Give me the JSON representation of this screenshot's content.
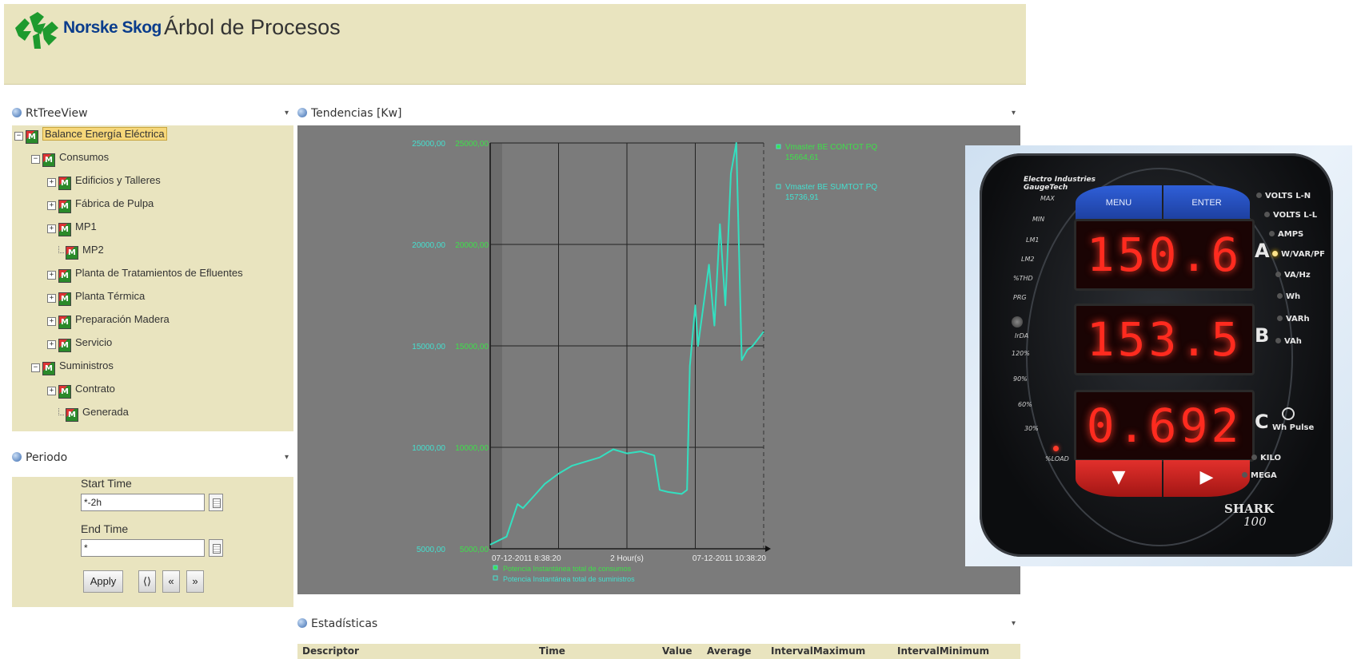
{
  "header": {
    "brand": "Norske Skog",
    "title": "Árbol de Procesos"
  },
  "tree_panel": {
    "title": "RtTreeView",
    "items": [
      {
        "label": "Balance Energía Eléctrica",
        "toggle": "−",
        "selected": true
      },
      {
        "label": "Consumos",
        "toggle": "−"
      },
      {
        "label": "Edificios y Talleres",
        "toggle": "+"
      },
      {
        "label": "Fábrica de Pulpa",
        "toggle": "+"
      },
      {
        "label": "MP1",
        "toggle": "+"
      },
      {
        "label": "MP2",
        "toggle": ""
      },
      {
        "label": "Planta de Tratamientos de Efluentes",
        "toggle": "+"
      },
      {
        "label": "Planta Térmica",
        "toggle": "+"
      },
      {
        "label": "Preparación Madera",
        "toggle": "+"
      },
      {
        "label": "Servicio",
        "toggle": "+"
      },
      {
        "label": "Suministros",
        "toggle": "−"
      },
      {
        "label": "Contrato",
        "toggle": "+"
      },
      {
        "label": "Generada",
        "toggle": ""
      }
    ]
  },
  "period_panel": {
    "title": "Periodo",
    "start_label": "Start Time",
    "start_value": "*-2h",
    "end_label": "End Time",
    "end_value": "*",
    "apply_label": "Apply",
    "btn_cycle": "⟨⟩",
    "btn_back": "«",
    "btn_forward": "»"
  },
  "trend_panel": {
    "title": "Tendencias [Kw]"
  },
  "chart_data": {
    "type": "line",
    "y_ticks": [
      "25000,00",
      "20000,00",
      "15000,00",
      "10000,00",
      "5000,00"
    ],
    "y_tick_values": [
      25000,
      20000,
      15000,
      10000,
      5000
    ],
    "ylim": [
      5000,
      25000
    ],
    "x_labels": {
      "start": "07-12-2011 8:38:20",
      "span": "2 Hour(s)",
      "end": "07-12-2011 10:38:20"
    },
    "series": [
      {
        "name": "Potencia Instantánea total de consumos",
        "tag": "Vmaster BE CONTOT PQ",
        "value": "15664,61",
        "color": "#33e0c0"
      },
      {
        "name": "Potencia Instantánea total de suministros",
        "tag": "Vmaster BE SUMTOT PQ",
        "value": "15736,91",
        "color": "#33e0c0"
      }
    ],
    "x": [
      0,
      0.03,
      0.06,
      0.1,
      0.12,
      0.16,
      0.2,
      0.25,
      0.3,
      0.35,
      0.4,
      0.45,
      0.5,
      0.55,
      0.6,
      0.62,
      0.65,
      0.7,
      0.72,
      0.73,
      0.75,
      0.76,
      0.8,
      0.82,
      0.84,
      0.86,
      0.88,
      0.9,
      0.92,
      0.94,
      0.96,
      1.0
    ],
    "y": [
      5200,
      5400,
      5600,
      7200,
      7000,
      7600,
      8200,
      8700,
      9100,
      9300,
      9500,
      9900,
      9700,
      9800,
      9600,
      7900,
      7800,
      7700,
      7900,
      14000,
      17000,
      15000,
      19000,
      16000,
      21000,
      17000,
      23500,
      25000,
      14300,
      14800,
      15000,
      15700
    ]
  },
  "stats_panel": {
    "title": "Estadísticas",
    "columns": [
      "Descriptor",
      "Time",
      "Value",
      "Average",
      "IntervalMaximum",
      "IntervalMinimum"
    ]
  },
  "meter": {
    "brand_line1": "Electro Industries",
    "brand_line2": "GaugeTech",
    "menu_label": "MENU",
    "enter_label": "ENTER",
    "display_a": "150.6",
    "display_b": "153.5",
    "display_c": "0.692",
    "letter_a": "A",
    "letter_b": "B",
    "letter_c": "C",
    "right_labels": [
      "VOLTS L-N",
      "VOLTS L-L",
      "AMPS",
      "W/VAR/PF",
      "VA/Hz",
      "Wh",
      "VARh",
      "VAh"
    ],
    "active_label_index": 3,
    "left_labels": [
      "MAX",
      "MIN",
      "LM1",
      "LM2",
      "%THD",
      "PRG",
      "IrDA",
      "120%",
      "90%",
      "60%",
      "30%",
      "%LOAD"
    ],
    "wh_pulse": "Wh Pulse",
    "kilo": "KILO",
    "mega": "MEGA",
    "model_line1": "SHARK",
    "model_line2": "100"
  }
}
